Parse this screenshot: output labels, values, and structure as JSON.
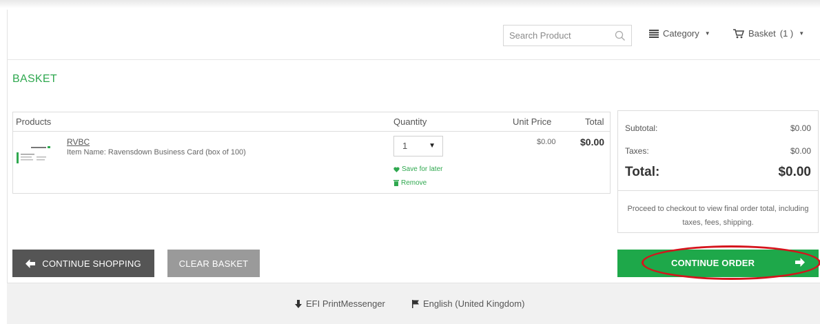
{
  "header": {
    "search_placeholder": "Search Product",
    "category_label": "Category",
    "basket_label": "Basket",
    "basket_count": "(1 )"
  },
  "page": {
    "title": "BASKET"
  },
  "products_table": {
    "columns": [
      "Products",
      "Quantity",
      "Unit Price",
      "Total"
    ],
    "items": [
      {
        "sku": "RVBC",
        "name": "Item Name: Ravensdown Business Card (box of 100)",
        "quantity": "1",
        "save_for_later": "Save for later",
        "remove": "Remove",
        "unit_price": "$0.00",
        "total": "$0.00"
      }
    ]
  },
  "summary": {
    "subtotal_label": "Subtotal:",
    "subtotal_value": "$0.00",
    "taxes_label": "Taxes:",
    "taxes_value": "$0.00",
    "total_label": "Total:",
    "total_value": "$0.00",
    "note": "Proceed to checkout to view final order total, including taxes, fees, shipping."
  },
  "buttons": {
    "continue_shopping": "CONTINUE SHOPPING",
    "clear_basket": "CLEAR BASKET",
    "continue_order": "CONTINUE ORDER"
  },
  "footer": {
    "printmessenger": "EFI PrintMessenger",
    "language": "English (United Kingdom)"
  },
  "colors": {
    "accent_green": "#2fa84f",
    "button_green": "#1ea84a",
    "button_dark": "#555555",
    "button_gray": "#9a9a9a",
    "annotation_red": "#d4141c"
  },
  "icons": [
    "search-icon",
    "list-icon",
    "cart-icon",
    "caret-down-icon",
    "heart-icon",
    "trash-icon",
    "arrow-left-icon",
    "arrow-right-icon",
    "download-icon",
    "flag-icon"
  ]
}
